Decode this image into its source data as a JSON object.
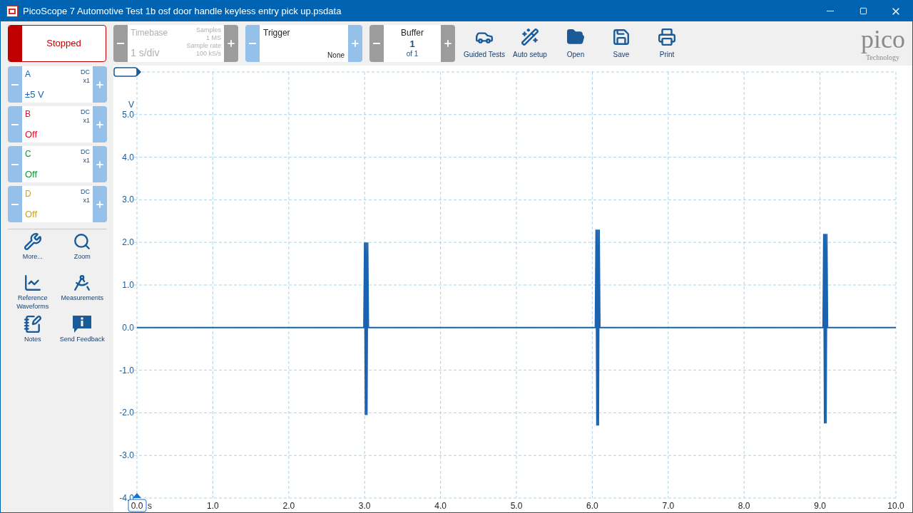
{
  "window": {
    "title": "PicoScope 7 Automotive Test 1b osf door handle keyless entry pick up.psdata"
  },
  "run_button": {
    "label": "Stopped",
    "running": false
  },
  "timebase": {
    "title": "Timebase",
    "value": "1 s/div",
    "samples_label": "Samples",
    "samples": "1 MS",
    "rate_label": "Sample rate",
    "rate": "100 kS/s",
    "disabled": true
  },
  "trigger": {
    "title": "Trigger",
    "mode": "None",
    "disabled": false
  },
  "buffer": {
    "title": "Buffer",
    "value": "1",
    "of": "of 1",
    "disabled": true
  },
  "toolbar": [
    {
      "kind": "car",
      "label": "Guided Tests"
    },
    {
      "kind": "wand",
      "label": "Auto setup"
    },
    {
      "kind": "folder",
      "label": "Open"
    },
    {
      "kind": "save",
      "label": "Save"
    },
    {
      "kind": "print",
      "label": "Print"
    }
  ],
  "logo": {
    "name": "pico",
    "tagline": "Technology"
  },
  "channels": [
    {
      "name": "A",
      "color": "#1a63b0",
      "coupling": "DC",
      "probe": "x1",
      "range": "±5 V"
    },
    {
      "name": "B",
      "color": "#e0102a",
      "coupling": "DC",
      "probe": "x1",
      "range": "Off"
    },
    {
      "name": "C",
      "color": "#13923c",
      "coupling": "DC",
      "probe": "x1",
      "range": "Off"
    },
    {
      "name": "D",
      "color": "#c9a233",
      "coupling": "DC",
      "probe": "x1",
      "range": "Off"
    }
  ],
  "tools": [
    {
      "kind": "wrench",
      "label": "More..."
    },
    {
      "kind": "zoom",
      "label": "Zoom"
    },
    {
      "kind": "reference",
      "label": "Reference Waveforms"
    },
    {
      "kind": "compass",
      "label": "Measurements"
    },
    {
      "kind": "notes",
      "label": "Notes"
    },
    {
      "kind": "feedback",
      "label": "Send Feedback"
    }
  ],
  "chart": {
    "chart_data": {
      "type": "line",
      "grid": true,
      "xlabel": "s",
      "ylabel": "V",
      "xlim": [
        0,
        10
      ],
      "ylim": [
        -4,
        6
      ],
      "xticks": [
        {
          "value": 0,
          "label": "0.0"
        },
        {
          "value": 1,
          "label": "1.0"
        },
        {
          "value": 2,
          "label": "2.0"
        },
        {
          "value": 3,
          "label": "3.0"
        },
        {
          "value": 4,
          "label": "4.0"
        },
        {
          "value": 5,
          "label": "5.0"
        },
        {
          "value": 6,
          "label": "6.0"
        },
        {
          "value": 7,
          "label": "7.0"
        },
        {
          "value": 8,
          "label": "8.0"
        },
        {
          "value": 9,
          "label": "9.0"
        },
        {
          "value": 10,
          "label": "10.0"
        }
      ],
      "yticks": [
        {
          "value": 5,
          "label": "5.0"
        },
        {
          "value": 4,
          "label": "4.0"
        },
        {
          "value": 3,
          "label": "3.0"
        },
        {
          "value": 2,
          "label": "2.0"
        },
        {
          "value": 1,
          "label": "1.0"
        },
        {
          "value": 0,
          "label": "0.0"
        },
        {
          "value": -1,
          "label": "-1.0"
        },
        {
          "value": -2,
          "label": "-2.0"
        },
        {
          "value": -3,
          "label": "-3.0"
        },
        {
          "value": -4,
          "label": "-4.0"
        }
      ],
      "x": [
        0,
        2.99,
        3.0,
        3.01,
        3.02,
        3.03,
        3.04,
        3.05,
        6.04,
        6.05,
        6.06,
        6.07,
        6.08,
        6.09,
        6.1,
        9.04,
        9.05,
        9.06,
        9.07,
        9.08,
        9.09,
        9.1,
        10
      ],
      "series": [
        {
          "color": "#1a63b0",
          "values": [
            0,
            0,
            2.0,
            -2.05,
            2.0,
            -2.05,
            2.0,
            0,
            0,
            2.3,
            -2.3,
            2.3,
            -2.3,
            2.3,
            0,
            0,
            2.2,
            -2.25,
            2.2,
            -2.25,
            2.2,
            0,
            0
          ]
        }
      ]
    }
  }
}
